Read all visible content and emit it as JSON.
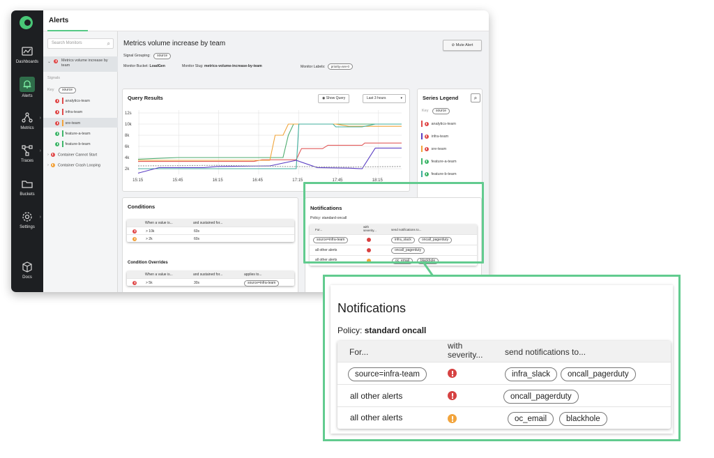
{
  "nav": {
    "items": [
      {
        "label": "Dashboards",
        "icon": "dashboard-icon"
      },
      {
        "label": "Alerts",
        "icon": "bell-icon"
      },
      {
        "label": "Metrics",
        "icon": "metrics-icon"
      },
      {
        "label": "Traces",
        "icon": "traces-icon"
      },
      {
        "label": "Buckets",
        "icon": "folder-icon"
      },
      {
        "label": "Settings",
        "icon": "gear-icon"
      },
      {
        "label": "Docs",
        "icon": "cube-icon"
      }
    ]
  },
  "header": {
    "title": "Alerts"
  },
  "sidebar": {
    "search_placeholder": "Search Monitors",
    "selected_monitor": "Metrics volume increase by team",
    "signals_label": "Signals",
    "key_label": "Key",
    "key_pill": "source",
    "signals": [
      {
        "label": "analytics-team",
        "status": "red",
        "bar": "#e04b4b"
      },
      {
        "label": "infra-team",
        "status": "red",
        "bar": "#e04b4b"
      },
      {
        "label": "sre-team",
        "status": "red",
        "bar": "#f2a23a"
      },
      {
        "label": "feature-a-team",
        "status": "green",
        "bar": "#3fb66a"
      },
      {
        "label": "feature-b-team",
        "status": "green",
        "bar": "#3fb66a"
      }
    ],
    "other_monitors": [
      {
        "label": "Container Cannot Start",
        "status": "red"
      },
      {
        "label": "Container Crash Looping",
        "status": "orange"
      }
    ]
  },
  "monitor": {
    "title": "Metrics volume increase by team",
    "signal_grouping_label": "Signal Grouping:",
    "signal_grouping_value": "source",
    "bucket_label": "Monitor Bucket:",
    "bucket_value": "LoadGen",
    "slug_label": "Monitor Slug:",
    "slug_value": "metrics-volume-increase-by-team",
    "labels_label": "Monitor Labels:",
    "labels_value": "priority=sev-0",
    "mute_label": "Mute Alert"
  },
  "query": {
    "title": "Query Results",
    "show_query_label": "Show Query",
    "range_label": "Last 3 hours"
  },
  "chart_data": {
    "type": "line",
    "x": [
      "15:15",
      "15:45",
      "16:15",
      "16:45",
      "17:15",
      "17:45",
      "18:15"
    ],
    "ylim": [
      1,
      12.5
    ],
    "yticks": [
      "12s",
      "10k",
      "8k",
      "6k",
      "4k",
      "2k"
    ],
    "ytick_values": [
      12,
      10,
      8,
      6,
      4,
      2
    ],
    "series": [
      {
        "color": "#e25b5b",
        "points": [
          [
            0,
            3.3
          ],
          [
            0.2,
            3.3
          ],
          [
            0.44,
            3.3
          ],
          [
            0.47,
            3.6
          ],
          [
            0.6,
            3.6
          ],
          [
            0.62,
            5.6
          ],
          [
            0.7,
            5.6
          ],
          [
            0.72,
            6.2
          ],
          [
            0.85,
            6.2
          ],
          [
            0.86,
            6.6
          ],
          [
            1,
            6.6
          ]
        ]
      },
      {
        "color": "#4cab6d",
        "points": [
          [
            0,
            3.7
          ],
          [
            0.15,
            4.0
          ],
          [
            0.55,
            4.0
          ],
          [
            0.57,
            8.0
          ],
          [
            0.59,
            10.0
          ],
          [
            0.72,
            10.0
          ],
          [
            0.85,
            10.0
          ],
          [
            1,
            10.0
          ]
        ]
      },
      {
        "color": "#f0a43a",
        "points": [
          [
            0,
            3.5
          ],
          [
            0.5,
            3.5
          ],
          [
            0.52,
            8.0
          ],
          [
            0.55,
            8.0
          ],
          [
            0.57,
            10.0
          ],
          [
            0.75,
            10.0
          ],
          [
            0.8,
            9.6
          ],
          [
            1,
            9.6
          ]
        ]
      },
      {
        "color": "#3fae9c",
        "points": [
          [
            0,
            2.0
          ],
          [
            0.6,
            2.0
          ],
          [
            0.61,
            10.0
          ],
          [
            0.74,
            10.0
          ],
          [
            0.75,
            9.5
          ],
          [
            0.85,
            9.5
          ],
          [
            0.9,
            10.0
          ],
          [
            1,
            10.0
          ]
        ]
      },
      {
        "color": "#5b3fc4",
        "points": [
          [
            0,
            1.2
          ],
          [
            0.08,
            2.2
          ],
          [
            0.25,
            2.2
          ],
          [
            0.3,
            2.4
          ],
          [
            0.5,
            2.5
          ],
          [
            0.6,
            3.5
          ],
          [
            0.68,
            2.2
          ],
          [
            0.8,
            2.1
          ],
          [
            0.85,
            2.0
          ],
          [
            0.9,
            5.7
          ],
          [
            1,
            5.7
          ]
        ]
      },
      {
        "color": "#999999",
        "points": [
          [
            0,
            2.5
          ],
          [
            0.3,
            2.6
          ],
          [
            0.55,
            2.4
          ],
          [
            0.8,
            2.3
          ],
          [
            1,
            2.4
          ]
        ]
      }
    ]
  },
  "legend": {
    "title": "Series Legend",
    "key_label": "Key",
    "key_pill": "source",
    "items": [
      {
        "label": "analytics-team",
        "status": "red",
        "bar": "#e04b4b"
      },
      {
        "label": "infra-team",
        "status": "red",
        "bar": "#5b3fc4"
      },
      {
        "label": "sre-team",
        "status": "red",
        "bar": "#f2a23a"
      },
      {
        "label": "feature-a-team",
        "status": "green",
        "bar": "#3fb66a"
      },
      {
        "label": "feature-b-team",
        "status": "green",
        "bar": "#3fae9c"
      }
    ]
  },
  "conditions": {
    "title": "Conditions",
    "col_value": "When a value is...",
    "col_sustained": "and sustained for...",
    "rows": [
      {
        "status": "red",
        "value": "> 10k",
        "sustained": "60s"
      },
      {
        "status": "orange",
        "value": "> 2k",
        "sustained": "60s"
      }
    ],
    "overrides_title": "Condition Overrides",
    "overrides_col_applies": "applies to...",
    "override_rows": [
      {
        "status": "red",
        "value": "> 5k",
        "sustained": "30s",
        "applies": "source=infra-team"
      }
    ]
  },
  "notifications_small": {
    "title": "Notifications",
    "policy": "Policy: standard-oncall",
    "col_for": "For...",
    "col_severity": "with severity...",
    "col_send": "send notifications to...",
    "rows": [
      {
        "for": "source=infra-team",
        "for_pill": true,
        "severity": "red",
        "targets": [
          "infra_slack",
          "oncall_pagerduty"
        ]
      },
      {
        "for": "all other alerts",
        "for_pill": false,
        "severity": "red",
        "targets": [
          "oncall_pagerduty"
        ]
      },
      {
        "for": "all other alerts",
        "for_pill": false,
        "severity": "orange",
        "targets": [
          "oc_email",
          "blackhole"
        ]
      }
    ]
  },
  "notifications_zoom": {
    "title": "Notifications",
    "policy_label": "Policy:",
    "policy_value": "standard oncall",
    "col_for": "For...",
    "col_severity_1": "with",
    "col_severity_2": "severity...",
    "col_send": "send notifications to...",
    "rows": [
      {
        "for": "source=infra-team",
        "severity": "red",
        "targets": [
          "infra_slack",
          "oncall_pagerduty"
        ]
      },
      {
        "for": "all other alerts",
        "severity": "red",
        "targets": [
          "oncall_pagerduty"
        ]
      },
      {
        "for": "all other alerts",
        "severity": "orange",
        "targets": [
          "oc_email",
          "blackhole"
        ]
      }
    ]
  },
  "colors": {
    "accent": "#62cb8f",
    "nav_bg": "#1d1f22",
    "error": "#e04b4b",
    "warning": "#f2a23a",
    "ok": "#3fb66a"
  }
}
